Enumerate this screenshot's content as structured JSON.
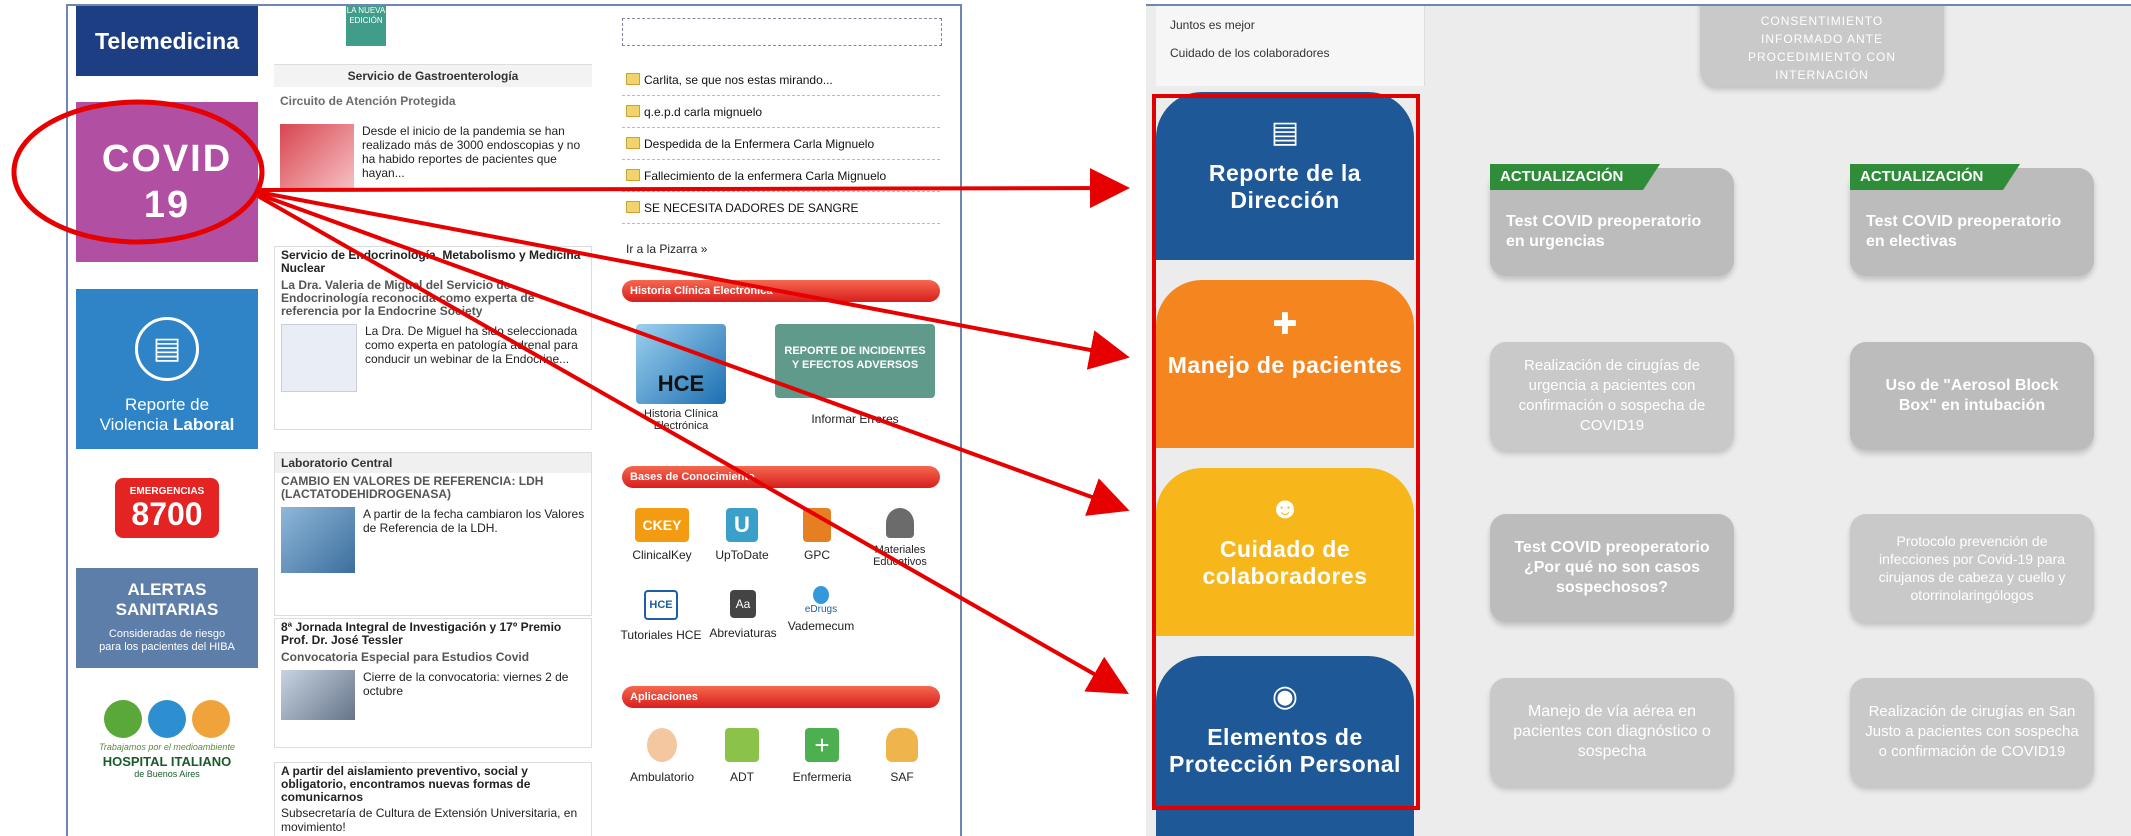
{
  "left_sidebar": {
    "telemedicina": "Telemedicina",
    "covid_line1": "COVID",
    "covid_line2": "19",
    "violencia_line1": "Reporte de",
    "violencia_line2a": "Violencia ",
    "violencia_line2b": "Laboral",
    "emergencias_label": "EMERGENCIAS",
    "emergencias_number": "8700",
    "alertas_title_1": "ALERTAS",
    "alertas_title_2": "SANITARIAS",
    "alertas_sub_1": "Consideradas de riesgo",
    "alertas_sub_2": "para los pacientes del HIBA",
    "hiba_slogan": "Trabajamos por el medioambiente",
    "hiba_name": "HOSPITAL ITALIANO",
    "hiba_city": "de Buenos Aires"
  },
  "news": {
    "thumb1_caption": "LA NUEVA EDICIÓN",
    "block1_head": "Servicio de Gastroenterología",
    "block1_sub": "Circuito de Atención Protegida",
    "block1_text": "Desde el inicio de la pandemia se han realizado más de 3000 endoscopias y no ha habido reportes de pacientes que hayan...",
    "block2_title": "Servicio de Endocrinología, Metabolismo y Medicina Nuclear",
    "block2_sub": "La Dra. Valeria de Miguel del Servicio de Endocrinología reconocida como experta de referencia por la Endocrine Society",
    "block2_text": "La Dra. De Miguel ha sido seleccionada como experta en patología adrenal para conducir un webinar de la Endocrine...",
    "block3_head": "Laboratorio Central",
    "block3_sub": "CAMBIO EN VALORES DE REFERENCIA: LDH (LACTATODEHIDROGENASA)",
    "block3_text": "A partir de la fecha cambiaron los Valores de Referencia de la LDH.",
    "block4_title": "8ª Jornada Integral de Investigación y 17º Premio Prof. Dr. José Tessler",
    "block4_sub": "Convocatoria Especial para Estudios Covid",
    "block4_text": "Cierre de la convocatoria: viernes 2 de octubre",
    "block5_title": "A partir del aislamiento preventivo, social y obligatorio, encontramos nuevas formas de comunicarnos",
    "block5_text": "Subsecretaría de Cultura de Extensión Universitaria, en movimiento!"
  },
  "links": {
    "pizarra_items": [
      "Carlita, se que nos estas mirando...",
      "q.e.p.d carla mignuelo",
      "Despedida de la Enfermera Carla Mignuelo",
      "Fallecimiento de la enfermera Carla Mignuelo",
      "SE NECESITA DADORES DE SANGRE"
    ],
    "pizarra_link": "Ir a la Pizarra »",
    "hce_section": "Historia Clínica Electrónica",
    "hce_tile": "Historia Clínica Electrónica",
    "hce_logo": "HCE",
    "report_line1": "REPORTE DE INCIDENTES",
    "report_line2": "Y EFECTOS ADVERSOS",
    "report_tile": "Informar Errores",
    "bases_section": "Bases de Conocimiento",
    "bases": [
      "ClinicalKey",
      "UpToDate",
      "GPC",
      "Materiales Educativos",
      "Tutoriales HCE",
      "Abreviaturas",
      "Vademecum"
    ],
    "bases_extra": {
      "ckey": "CKEY",
      "upto": "U",
      "hce": "HCE",
      "aa": "Aa",
      "edrugs": "eDrugs"
    },
    "apps_section": "Aplicaciones",
    "apps": [
      "Ambulatorio",
      "ADT",
      "Enfermeria",
      "SAF"
    ]
  },
  "right": {
    "nav_items": [
      "Juntos es mejor",
      "Cuidado de los colaboradores"
    ],
    "cards": [
      {
        "label": "Reporte de la Dirección",
        "icon": "clipboard-icon",
        "color": "#1e5896"
      },
      {
        "label": "Manejo de pacientes",
        "icon": "medkit-icon",
        "color": "#f5861f"
      },
      {
        "label": "Cuidado de colaboradores",
        "icon": "people-icon",
        "color": "#f7b71b"
      },
      {
        "label": "Elementos de Protección Personal",
        "icon": "mask-icon",
        "color": "#1e5896"
      }
    ],
    "top_button": "CONSENTIMIENTO INFORMADO ANTE PROCEDIMIENTO CON INTERNACIÓN",
    "badge_label": "ACTUALIZACIÓN",
    "buttons": [
      "Test COVID preoperatorio en urgencias",
      "Test COVID preoperatorio en electivas",
      "Realización de cirugías de urgencia a pacientes con confirmación o sospecha de COVID19",
      "Uso de \"Aerosol Block Box\" en intubación",
      "Test COVID preoperatorio ¿Por qué no son casos sospechosos?",
      "Protocolo prevención de infecciones por Covid-19 para cirujanos de cabeza y cuello y otorrinolaringólogos",
      "Manejo de vía aérea en pacientes con diagnóstico o sospecha",
      "Realización de cirugías en San Justo a pacientes con sospecha o confirmación de COVID19"
    ]
  },
  "colors": {
    "arrow_red": "#e60000",
    "telemedicina_bg": "#1d3e83",
    "covid_bg": "#b14fa2",
    "violencia_bg": "#2f84c8",
    "badge_green": "#2f8d3a",
    "grey_button": "#c9c9c9"
  }
}
